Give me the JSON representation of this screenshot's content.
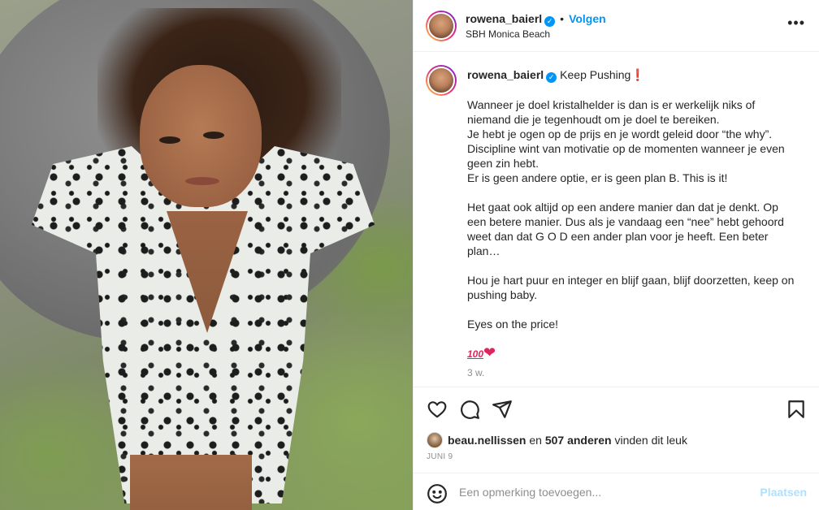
{
  "post": {
    "username": "rowena_baierl",
    "verified_icon": "verified-badge-icon",
    "dot": "•",
    "follow_label": "Volgen",
    "location": "SBH Monica Beach",
    "more_icon": "more-options-icon"
  },
  "caption": {
    "username": "rowena_baierl",
    "title": "Keep Pushing",
    "title_emoji": "❗",
    "paragraphs": [
      [
        "Wanneer je doel kristalhelder is dan is er werkelijk niks of niemand die je tegenhoudt om je doel te bereiken.",
        "Je hebt je ogen op de prijs en je wordt geleid door “the why”.",
        "Discipline wint van motivatie op de momenten wanneer je even geen zin hebt.",
        "Er is geen andere optie, er is geen plan B. This is it!"
      ],
      [
        "Het gaat ook altijd op een andere manier dan dat je denkt. Op een betere manier. Dus als je vandaag een “nee” hebt gehoord weet dan dat G O D een ander plan voor je heeft. Een beter plan…"
      ],
      [
        "Hou je hart puur en integer en blijf gaan, blijf doorzetten, keep on pushing baby."
      ],
      [
        "Eyes on the price!"
      ]
    ],
    "emoji_hundred": "100",
    "emoji_heart": "❤",
    "time_ago": "3 w."
  },
  "actions": {
    "like_icon": "heart-icon",
    "comment_icon": "comment-icon",
    "share_icon": "share-icon",
    "save_icon": "bookmark-icon"
  },
  "likes": {
    "liker": "beau.nellissen",
    "connector": "en",
    "others": "507 anderen",
    "suffix": "vinden dit leuk"
  },
  "date": "JUNI 9",
  "comment": {
    "placeholder": "Een opmerking toevoegen...",
    "post_label": "Plaatsen",
    "emoji_icon": "smiley-icon"
  },
  "colors": {
    "accent": "#0095f6",
    "post_disabled": "#b2dffc",
    "muted": "#8e8e8e",
    "heart": "#e0245e"
  }
}
